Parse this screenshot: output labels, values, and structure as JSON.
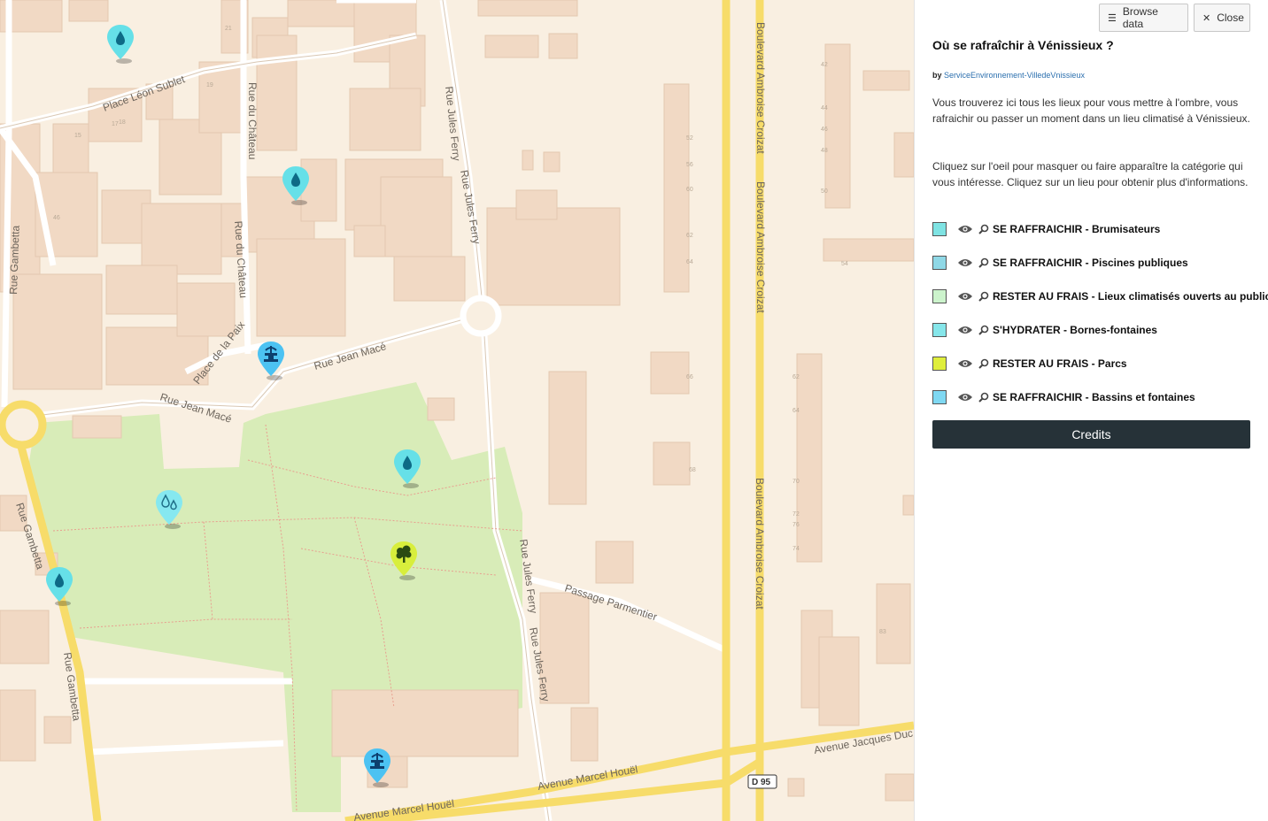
{
  "map": {
    "streets": {
      "place_leon_sublet": "Place Léon Sublet",
      "rue_du_chateau": "Rue du Château",
      "rue_gambetta": "Rue Gambetta",
      "rue_jules_ferry": "Rue Jules Ferry",
      "rue_jules_ferry_b": "Rue Jules Ferry",
      "boulevard_croizat": "Boulevard Ambroise Croizat",
      "place_de_la_paix": "Place de la Paix",
      "rue_jean_mace": "Rue Jean Macé",
      "passage_parmentier": "Passage Parmentier",
      "avenue_marcel_houel": "Avenue Marcel Houël",
      "avenue_jacques_duclos": "Avenue Jacques Duc",
      "road_shield": "D 95"
    },
    "house_numbers": [
      "21",
      "19",
      "17",
      "15",
      "18",
      "46",
      "52",
      "56",
      "60",
      "62",
      "64",
      "66",
      "68",
      "42",
      "44",
      "46",
      "48",
      "50",
      "54",
      "62",
      "64",
      "70",
      "72",
      "74",
      "76",
      "83"
    ],
    "markers": [
      {
        "kind": "drop",
        "color": "#66e0e8",
        "icon": "water-drop-icon",
        "layer": "Brumisateurs"
      },
      {
        "kind": "drop",
        "color": "#66e0e8",
        "icon": "water-drop-icon",
        "layer": "Brumisateurs"
      },
      {
        "kind": "fountain",
        "color": "#4cc2f2",
        "icon": "fountain-icon",
        "layer": "Bassins et fontaines"
      },
      {
        "kind": "drop",
        "color": "#66e0e8",
        "icon": "water-drop-icon",
        "layer": "Brumisateurs"
      },
      {
        "kind": "drops",
        "color": "#86e8f0",
        "icon": "water-drops-outline-icon",
        "layer": "Bornes-fontaines"
      },
      {
        "kind": "drop",
        "color": "#66e0e8",
        "icon": "water-drop-icon",
        "layer": "Brumisateurs"
      },
      {
        "kind": "tree",
        "color": "#d8ee3c",
        "icon": "tree-icon",
        "layer": "Parcs"
      },
      {
        "kind": "fountain",
        "color": "#4cc2f2",
        "icon": "fountain-icon",
        "layer": "Bassins et fontaines"
      }
    ]
  },
  "panel": {
    "browse_label": "Browse data",
    "close_label": "Close",
    "title": "Où se rafraîchir à Vénissieux ?",
    "by_label": "by",
    "author": "ServiceEnvironnement-VilledeVnissieux",
    "description_1": "Vous trouverez ici tous les lieux pour vous mettre à l'ombre, vous rafraichir ou passer un moment dans un lieu climatisé à Vénissieux.",
    "description_2": "Cliquez sur l'oeil pour masquer ou faire apparaître la catégorie qui vous intéresse. Cliquez sur un lieu pour obtenir plus d'informations.",
    "layers": [
      {
        "label": "SE RAFFRAICHIR - Brumisateurs",
        "color": "#7fe3e3"
      },
      {
        "label": "SE RAFFRAICHIR - Piscines publiques",
        "color": "#8fd8e6"
      },
      {
        "label": "RESTER AU FRAIS - Lieux climatisés ouverts au public",
        "color": "#ccf3cc"
      },
      {
        "label": "S'HYDRATER - Bornes-fontaines",
        "color": "#86e6ea"
      },
      {
        "label": "RESTER AU FRAIS - Parcs",
        "color": "#dfee3c"
      },
      {
        "label": "SE RAFFRAICHIR - Bassins et fontaines",
        "color": "#7fd8f2"
      }
    ],
    "credits_label": "Credits"
  }
}
